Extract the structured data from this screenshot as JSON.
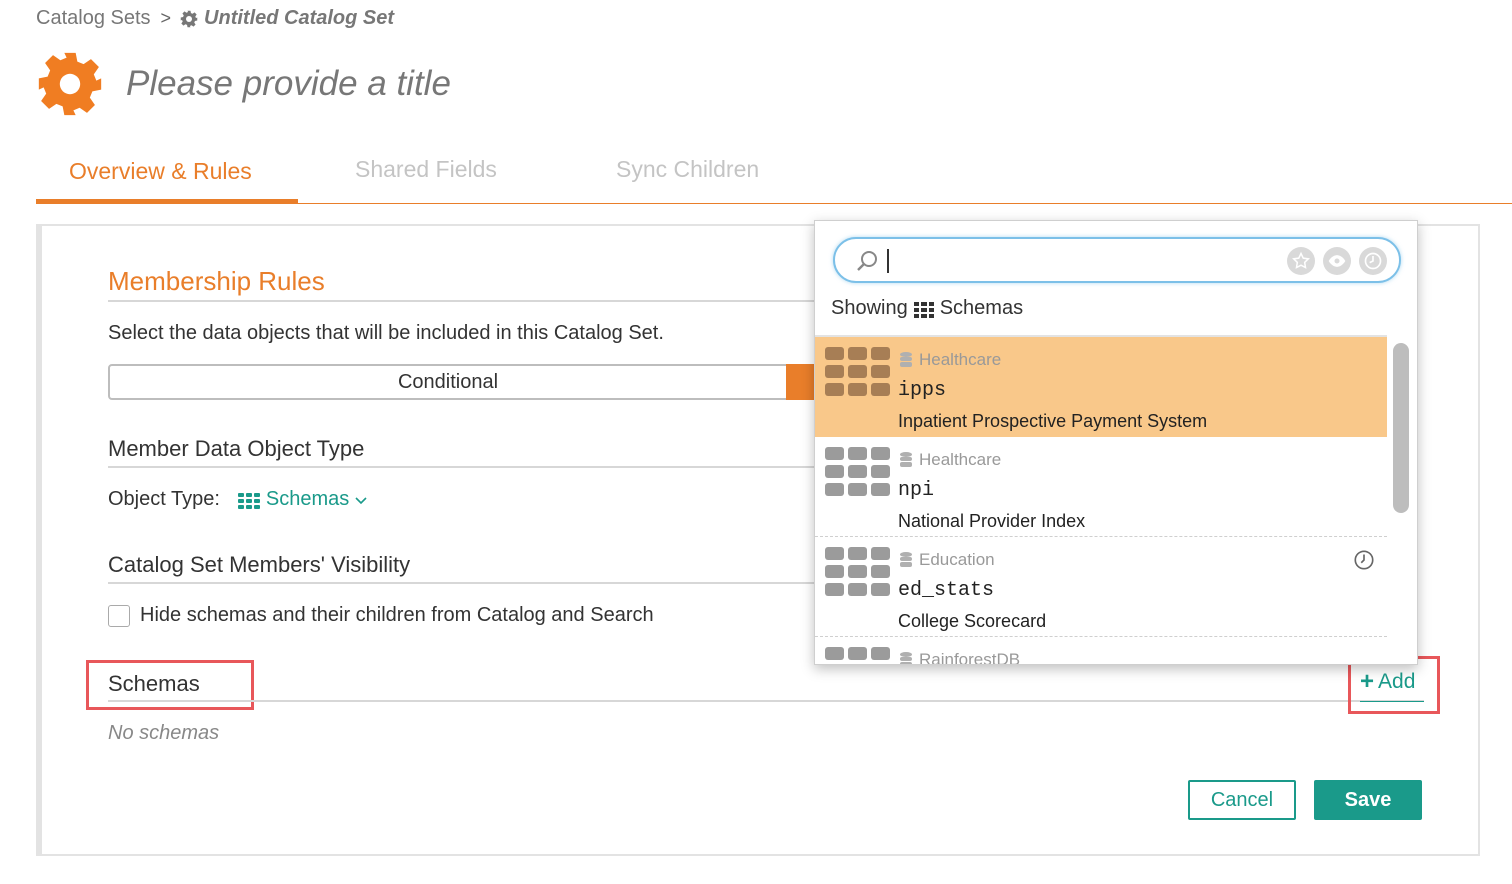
{
  "breadcrumb": {
    "parent": "Catalog Sets",
    "separator": ">",
    "current": "Untitled Catalog Set"
  },
  "page": {
    "title": "Please provide a title",
    "icon": "gear-icon",
    "accent_color": "#e97e2a"
  },
  "tabs": [
    {
      "label": "Overview & Rules",
      "active": true
    },
    {
      "label": "Shared Fields",
      "active": false
    },
    {
      "label": "Sync Children",
      "active": false
    }
  ],
  "membership": {
    "title": "Membership Rules",
    "description": "Select the data objects that will be included in this Catalog Set.",
    "mode_label": "Conditional"
  },
  "member_type": {
    "title": "Member Data Object Type",
    "label": "Object Type:",
    "value": "Schemas"
  },
  "visibility": {
    "title": "Catalog Set Members' Visibility",
    "checkbox_label": "Hide schemas and their children from Catalog and Search",
    "checked": false
  },
  "schemas": {
    "title": "Schemas",
    "empty_text": "No schemas",
    "add_label": "Add"
  },
  "footer": {
    "cancel_label": "Cancel",
    "save_label": "Save",
    "teal_color": "#1a9a8a"
  },
  "dropdown": {
    "search_value": "",
    "filters": [
      "star-icon",
      "eye-icon",
      "clock-icon"
    ],
    "showing_prefix": "Showing",
    "showing_type": "Schemas",
    "items": [
      {
        "database": "Healthcare",
        "name": "ipps",
        "description": "Inpatient Prospective Payment System",
        "selected": true,
        "recent": false
      },
      {
        "database": "Healthcare",
        "name": "npi",
        "description": "National Provider Index",
        "selected": false,
        "recent": false
      },
      {
        "database": "Education",
        "name": "ed_stats",
        "description": "College Scorecard",
        "selected": false,
        "recent": true
      },
      {
        "database": "RainforestDB",
        "name": "",
        "description": "",
        "selected": false,
        "recent": false
      }
    ]
  }
}
